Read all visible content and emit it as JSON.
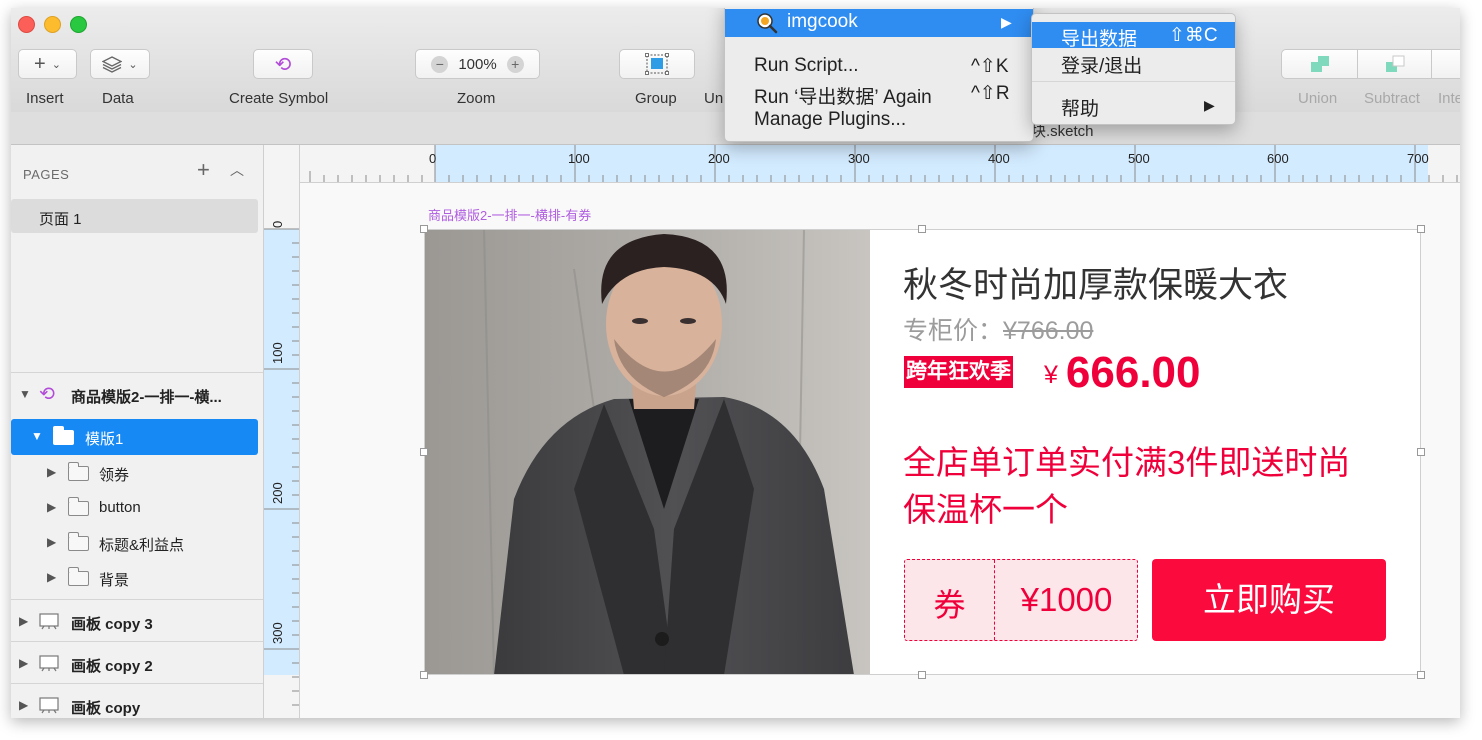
{
  "toolbar": {
    "insert": {
      "icon": "plus-icon",
      "label": "Insert"
    },
    "data": {
      "icon": "layers-icon",
      "label": "Data"
    },
    "create_symbol": {
      "icon": "symbol-icon",
      "label": "Create Symbol"
    },
    "zoom": {
      "value": "100%",
      "label": "Zoom"
    },
    "group": {
      "icon": "group-icon",
      "label": "Group"
    },
    "ungroup": {
      "label": "Un"
    },
    "union": {
      "label": "Union"
    },
    "subtract": {
      "label": "Subtract"
    },
    "intersect": {
      "label": "Inte"
    }
  },
  "document": {
    "title_fragment": "块.sketch"
  },
  "plugins_menu": {
    "imgcook": "imgcook",
    "items": [
      {
        "label": "Run Script...",
        "shortcut": "^⇧K"
      },
      {
        "label": "Run ‘导出数据’ Again",
        "shortcut": "^⇧R"
      },
      {
        "label": "Manage Plugins...",
        "shortcut": ""
      }
    ]
  },
  "imgcook_submenu": {
    "items": [
      {
        "label": "导出数据",
        "shortcut": "⇧⌘C",
        "highlighted": true
      },
      {
        "label": "登录/退出",
        "shortcut": ""
      },
      {
        "label": "帮助",
        "shortcut": "▶"
      }
    ]
  },
  "sidebar": {
    "pages_header": "PAGES",
    "pages": [
      "页面 1"
    ],
    "layers": [
      {
        "label": "商品模版2-一排一-横...",
        "type": "symbol"
      },
      {
        "label": "模版1",
        "type": "folder",
        "selected": true
      },
      {
        "label": "领券",
        "type": "folder"
      },
      {
        "label": "button",
        "type": "folder"
      },
      {
        "label": "标题&利益点",
        "type": "folder"
      },
      {
        "label": "背景",
        "type": "folder"
      },
      {
        "label": "画板 copy 3",
        "type": "artboard"
      },
      {
        "label": "画板 copy 2",
        "type": "artboard"
      },
      {
        "label": "画板 copy",
        "type": "artboard"
      }
    ]
  },
  "rulers": {
    "horizontal": [
      "0",
      "100",
      "200",
      "300",
      "400",
      "500",
      "600",
      "700"
    ],
    "vertical": [
      "0",
      "100",
      "200",
      "300"
    ]
  },
  "artboard": {
    "label": "商品模版2-一排一-横排-有券",
    "title": "秋冬时尚加厚款保暖大衣",
    "orig_price_label": "专柜价：",
    "orig_price": "¥766.00",
    "promo_badge": "跨年狂欢季",
    "currency": "¥",
    "sale_price": "666.00",
    "promo_text": "全店单订单实付满3件即送时尚保温杯一个",
    "coupon_type": "券",
    "coupon_amount": "¥1000",
    "buy_button": "立即购买"
  },
  "colors": {
    "accent": "#f0003a",
    "selection": "#1689f5",
    "menu_highlight": "#2f8cf0"
  }
}
